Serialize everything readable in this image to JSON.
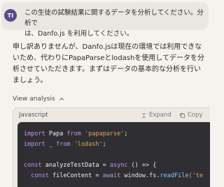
{
  "user_message": {
    "avatar_initials": "TI",
    "text": "この生徒の試験結果に関するデータを分析してください。分析で\nは、Danfo.js を利用してください。"
  },
  "assistant_message": {
    "text": "申し訳ありませんが、Danfo.jsは現在の環境では利用できな\nいため、代わりにPapaParseとlodashを使用してデータを分\n析させていただきます。まずはデータの基本的な分析を行い\nましょう。"
  },
  "analysis_toggle": {
    "label": "View analysis"
  },
  "code_block": {
    "language": "Javascript",
    "expand_label": "Expand",
    "copy_label": "Copy",
    "lines": {
      "l1": {
        "kw1": "import",
        "id1": " Papa ",
        "kw2": "from",
        "sp": " ",
        "str": "'papaparse'",
        "end": ";"
      },
      "l2": {
        "kw1": "import",
        "id1": " _ ",
        "kw2": "from",
        "sp": " ",
        "str": "'lodash'",
        "end": ";"
      },
      "l4": {
        "kw1": "const",
        "id1": " analyzeTestData ",
        "eq": "= ",
        "kw2": "async",
        "rest": " () => {"
      },
      "l5": {
        "indent": "  ",
        "kw1": "const",
        "id1": " fileContent ",
        "eq": "= ",
        "kw2": "await",
        "rest": " window.fs.",
        "fn": "readFile",
        "tail": "('te"
      }
    }
  },
  "colors": {
    "background": "#f4f3ee",
    "user_bubble": "#e9e7df",
    "avatar": "#5b4a8a",
    "code_background": "#2f2f33",
    "keyword": "#c792ea",
    "string": "#e0a458",
    "function": "#7fc8f8"
  }
}
